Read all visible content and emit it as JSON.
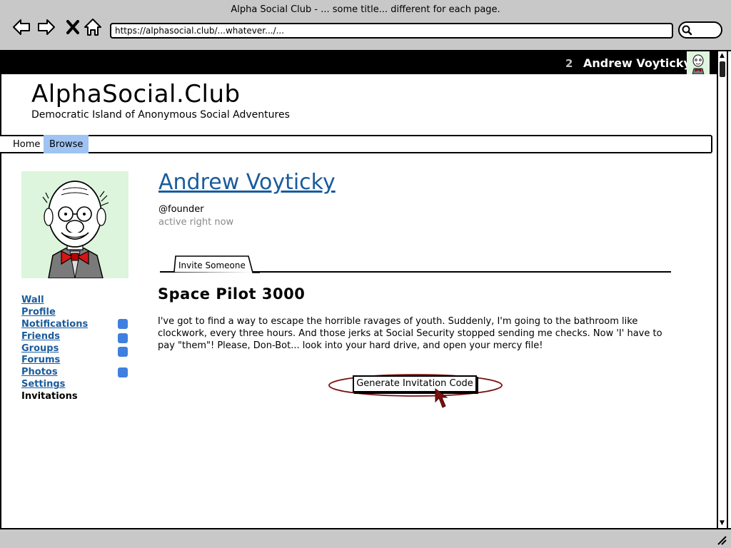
{
  "window": {
    "title": "Alpha Social Club - ... some title... different for each page."
  },
  "browser": {
    "url": "https://alphasocial.club/...whatever.../...",
    "back_icon": "back-arrow-icon",
    "forward_icon": "forward-arrow-icon",
    "stop_icon": "close-icon",
    "home_icon": "home-icon",
    "search_icon": "search-icon"
  },
  "topbar": {
    "notification_count": "2",
    "user_name": "Andrew Voyticky",
    "avatar_icon": "avatar"
  },
  "site": {
    "title": "AlphaSocial.Club",
    "tagline": "Democratic Island of Anonymous Social Adventures"
  },
  "nav": {
    "items": [
      {
        "label": "Home",
        "active": false
      },
      {
        "label": "Browse",
        "active": true
      }
    ]
  },
  "profile": {
    "name": "Andrew Voyticky",
    "handle": "@founder",
    "status": "active right now"
  },
  "sidebar": {
    "items": [
      {
        "label": "Wall",
        "badge": false,
        "current": false
      },
      {
        "label": "Profile",
        "badge": false,
        "current": false
      },
      {
        "label": "Notifications",
        "badge": true,
        "current": false
      },
      {
        "label": "Friends",
        "badge": true,
        "current": false
      },
      {
        "label": "Groups",
        "badge": true,
        "current": false
      },
      {
        "label": "Forums",
        "badge": false,
        "current": false
      },
      {
        "label": "Photos",
        "badge": true,
        "current": false
      },
      {
        "label": "Settings",
        "badge": false,
        "current": false
      },
      {
        "label": "Invitations",
        "badge": false,
        "current": true
      }
    ],
    "badge_color": "#3f7fe0"
  },
  "tabs": {
    "active_label": "Invite Someone"
  },
  "content": {
    "heading": "Space Pilot 3000",
    "body": "I've got to find a way to escape the horrible ravages of youth. Suddenly, I'm going to the bathroom like clockwork, every three hours. And those jerks at Social Security stopped sending me checks. Now 'I' have to pay \"them\"! Please, Don-Bot... look into your hard drive, and open your mercy file!",
    "button_label": "Generate Invitation Code"
  },
  "colors": {
    "link": "#1a5b9c",
    "nav_active": "#9fc3f3",
    "highlight": "#7a1010"
  }
}
